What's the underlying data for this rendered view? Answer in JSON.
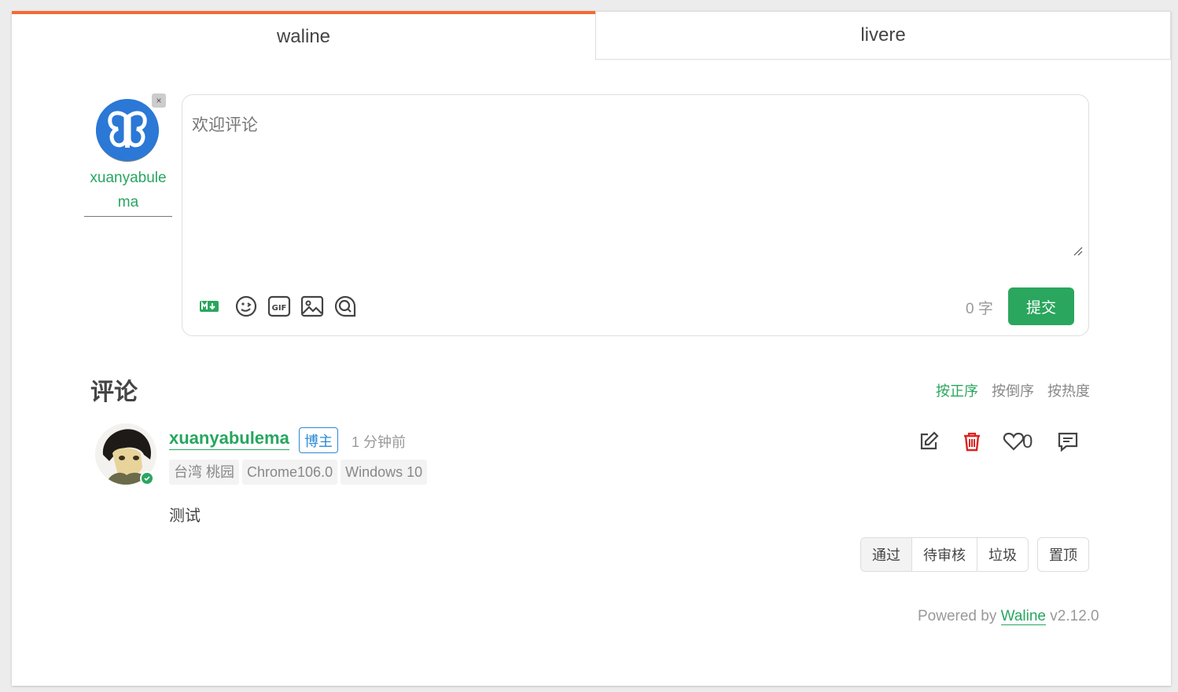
{
  "tabs": [
    {
      "label": "waline",
      "active": true
    },
    {
      "label": "livere",
      "active": false
    }
  ],
  "user": {
    "name": "xuanyabulema",
    "logout_label": "×"
  },
  "editor": {
    "placeholder": "欢迎评论",
    "word_count": "0 字",
    "submit_label": "提交",
    "toolbar_icons": [
      "markdown-icon",
      "emoji-icon",
      "gif-icon",
      "image-icon",
      "preview-icon"
    ]
  },
  "comments": {
    "title": "评论",
    "sort_options": [
      {
        "label": "按正序",
        "active": true
      },
      {
        "label": "按倒序",
        "active": false
      },
      {
        "label": "按热度",
        "active": false
      }
    ],
    "items": [
      {
        "author": "xuanyabulema",
        "badge": "博主",
        "time": "1 分钟前",
        "meta": [
          "台湾 桃园",
          "Chrome106.0",
          "Windows 10"
        ],
        "content": "测试",
        "likes": "0",
        "admin_actions": [
          "通过",
          "待审核",
          "垃圾"
        ],
        "pin_label": "置顶"
      }
    ]
  },
  "footer": {
    "powered_prefix": "Powered by",
    "powered_link": "Waline",
    "version": "v2.12.0"
  },
  "colors": {
    "accent_tab": "#f26b33",
    "primary_green": "#2aa65e",
    "badge_blue": "#2b8ad6",
    "delete_red": "#e02020"
  }
}
